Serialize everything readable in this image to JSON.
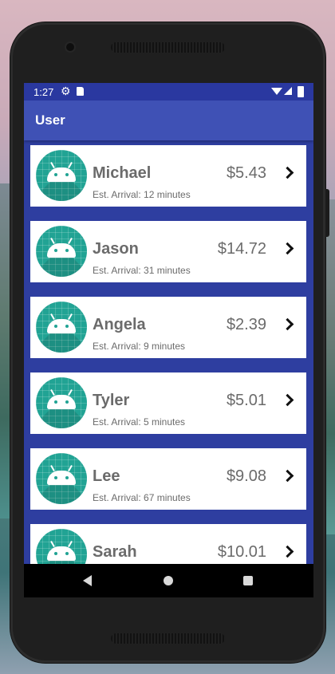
{
  "status_bar": {
    "time": "1:27",
    "icons": [
      "gear-icon",
      "sd-card-icon",
      "wifi-icon",
      "signal-icon",
      "battery-icon"
    ]
  },
  "app_bar": {
    "title": "User"
  },
  "colors": {
    "app_bar": "#3f51b5",
    "status_bar": "#2a38a0",
    "list_background": "#2e3ea0",
    "avatar": "#21a394",
    "card": "#ffffff",
    "text": "#6b6b6b"
  },
  "users": [
    {
      "name": "Michael",
      "price": "$5.43",
      "arrival": "Est. Arrival: 12 minutes"
    },
    {
      "name": "Jason",
      "price": "$14.72",
      "arrival": "Est. Arrival: 31 minutes"
    },
    {
      "name": "Angela",
      "price": "$2.39",
      "arrival": "Est. Arrival: 9 minutes"
    },
    {
      "name": "Tyler",
      "price": "$5.01",
      "arrival": "Est. Arrival: 5 minutes"
    },
    {
      "name": "Lee",
      "price": "$9.08",
      "arrival": "Est. Arrival: 67 minutes"
    },
    {
      "name": "Sarah",
      "price": "$10.01",
      "arrival": ""
    }
  ],
  "nav_bar": {
    "icons": [
      "back-icon",
      "home-icon",
      "recents-icon"
    ]
  }
}
